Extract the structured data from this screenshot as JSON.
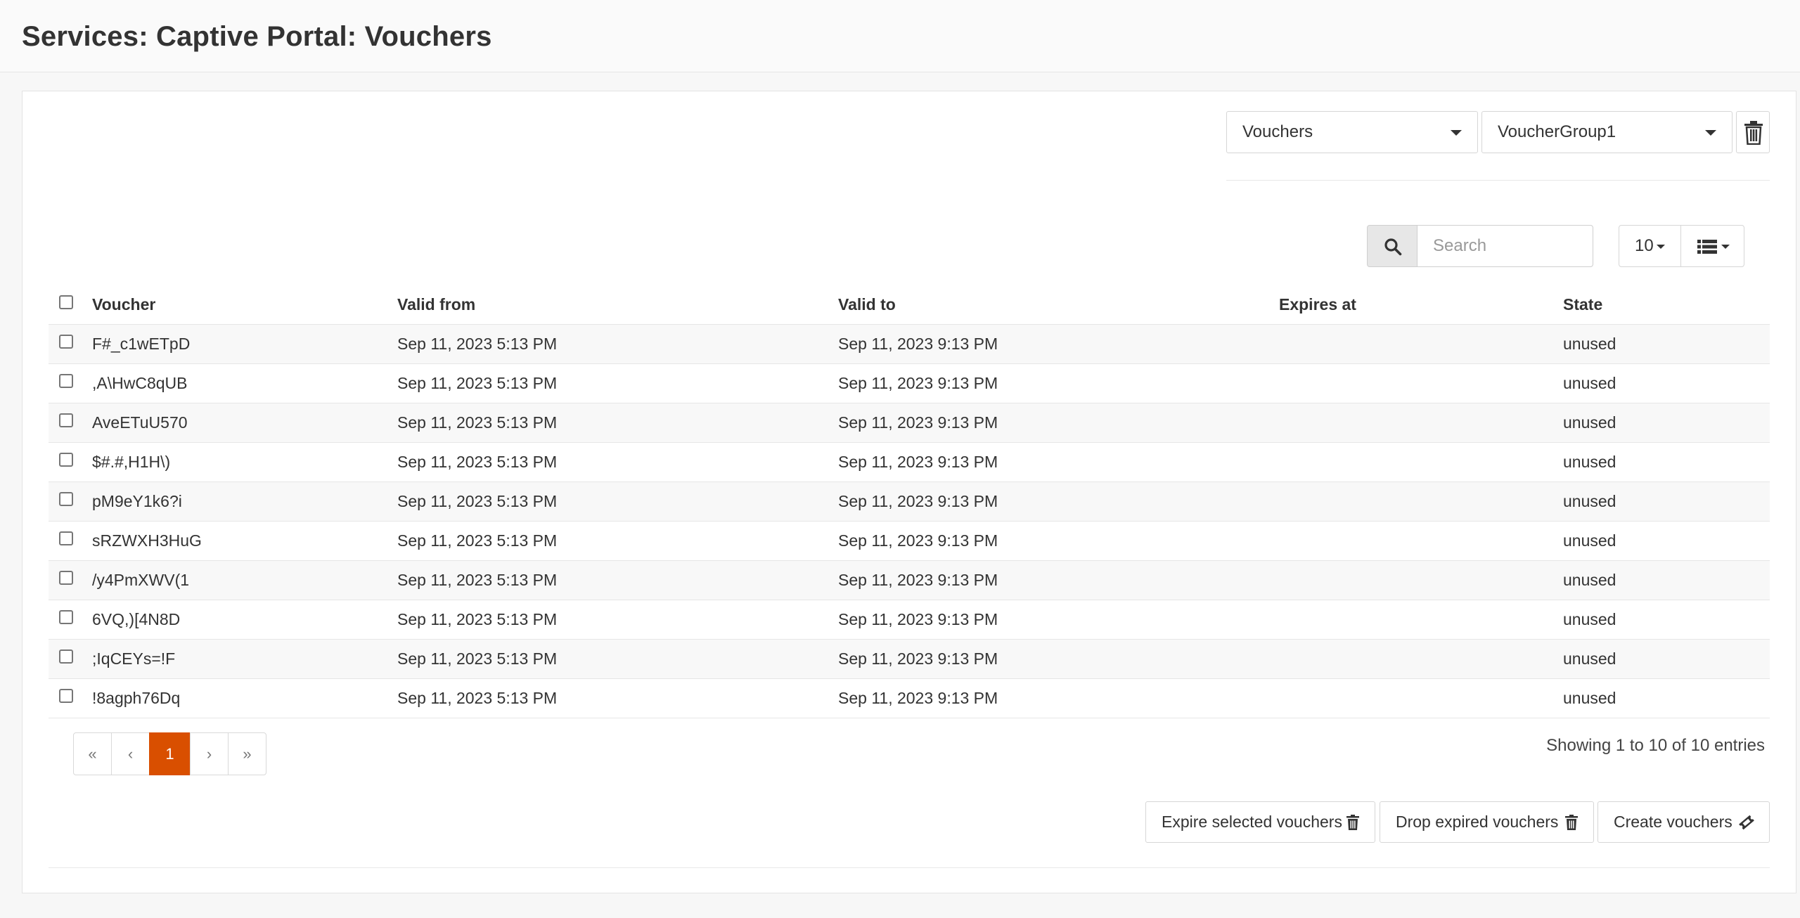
{
  "page": {
    "title": "Services: Captive Portal: Vouchers"
  },
  "filters": {
    "type_select": "Vouchers",
    "group_select": "VoucherGroup1"
  },
  "search": {
    "placeholder": "Search",
    "page_size": "10"
  },
  "table": {
    "headers": {
      "voucher": "Voucher",
      "valid_from": "Valid from",
      "valid_to": "Valid to",
      "expires_at": "Expires at",
      "state": "State"
    },
    "rows": [
      {
        "voucher": "F#_c1wETpD",
        "valid_from": "Sep 11, 2023 5:13 PM",
        "valid_to": "Sep 11, 2023 9:13 PM",
        "expires_at": "",
        "state": "unused"
      },
      {
        "voucher": ",A\\HwC8qUB",
        "valid_from": "Sep 11, 2023 5:13 PM",
        "valid_to": "Sep 11, 2023 9:13 PM",
        "expires_at": "",
        "state": "unused"
      },
      {
        "voucher": "AveETuU570",
        "valid_from": "Sep 11, 2023 5:13 PM",
        "valid_to": "Sep 11, 2023 9:13 PM",
        "expires_at": "",
        "state": "unused"
      },
      {
        "voucher": "$#.#,H1H\\)",
        "valid_from": "Sep 11, 2023 5:13 PM",
        "valid_to": "Sep 11, 2023 9:13 PM",
        "expires_at": "",
        "state": "unused"
      },
      {
        "voucher": "pM9eY1k6?i",
        "valid_from": "Sep 11, 2023 5:13 PM",
        "valid_to": "Sep 11, 2023 9:13 PM",
        "expires_at": "",
        "state": "unused"
      },
      {
        "voucher": "sRZWXH3HuG",
        "valid_from": "Sep 11, 2023 5:13 PM",
        "valid_to": "Sep 11, 2023 9:13 PM",
        "expires_at": "",
        "state": "unused"
      },
      {
        "voucher": "/y4PmXWV(1",
        "valid_from": "Sep 11, 2023 5:13 PM",
        "valid_to": "Sep 11, 2023 9:13 PM",
        "expires_at": "",
        "state": "unused"
      },
      {
        "voucher": "6VQ,)[4N8D",
        "valid_from": "Sep 11, 2023 5:13 PM",
        "valid_to": "Sep 11, 2023 9:13 PM",
        "expires_at": "",
        "state": "unused"
      },
      {
        "voucher": ";IqCEYs=!F",
        "valid_from": "Sep 11, 2023 5:13 PM",
        "valid_to": "Sep 11, 2023 9:13 PM",
        "expires_at": "",
        "state": "unused"
      },
      {
        "voucher": "!8agph76Dq",
        "valid_from": "Sep 11, 2023 5:13 PM",
        "valid_to": "Sep 11, 2023 9:13 PM",
        "expires_at": "",
        "state": "unused"
      }
    ]
  },
  "pagination": {
    "first": "«",
    "prev": "‹",
    "current": "1",
    "next": "›",
    "last": "»"
  },
  "entries_info": "Showing 1 to 10 of 10 entries",
  "actions": {
    "expire_selected": "Expire selected vouchers",
    "drop_expired": "Drop expired vouchers",
    "create": "Create vouchers"
  },
  "icons": {
    "trash": "trash-icon",
    "search": "search-icon",
    "columns": "list-icon",
    "ticket": "ticket-icon"
  },
  "colors": {
    "accent": "#d94f00"
  }
}
